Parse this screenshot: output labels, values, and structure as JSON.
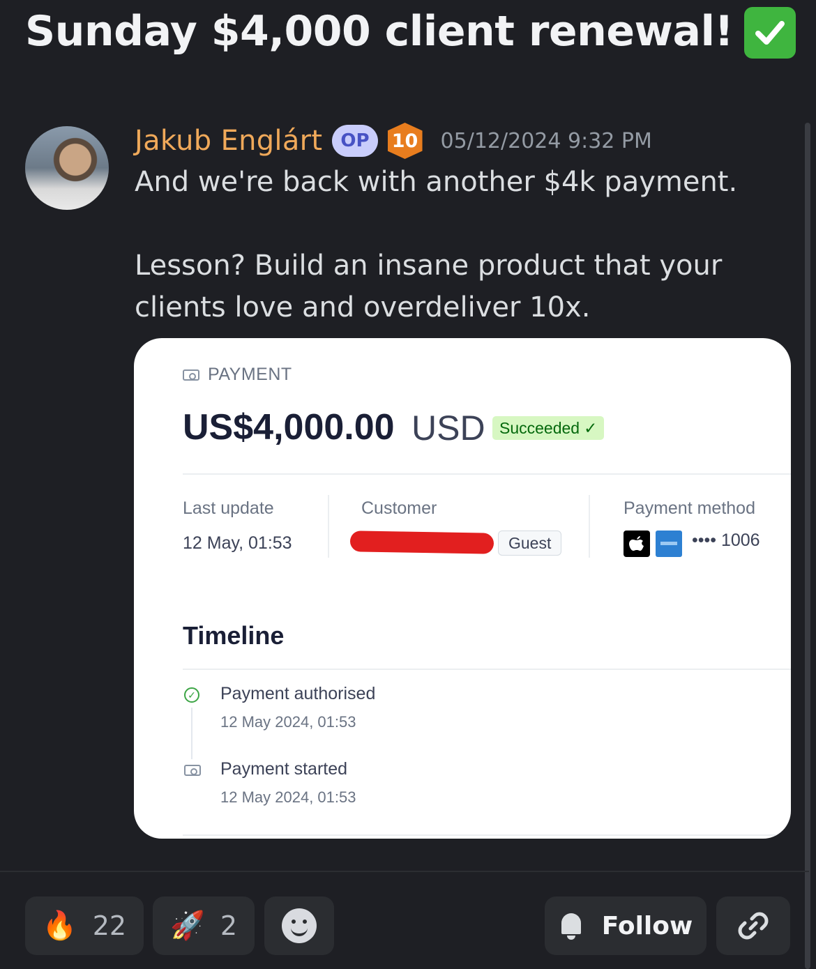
{
  "post": {
    "title": "Sunday $4,000 client renewal!",
    "title_emoji": "✅"
  },
  "message": {
    "author": "Jakub Englárt",
    "op_badge": "OP",
    "level_badge": "10",
    "timestamp": "05/12/2024 9:32 PM",
    "line1": "And we're back with another $4k payment.",
    "line2": "Lesson? Build an insane product that your clients love and overdeliver 10x."
  },
  "payment_card": {
    "header": "PAYMENT",
    "amount": "US$4,000.00",
    "currency": "USD",
    "status": "Succeeded",
    "status_mark": "✓",
    "last_update_label": "Last update",
    "last_update_value": "12 May, 01:53",
    "customer_label": "Customer",
    "customer_badge": "Guest",
    "payment_method_label": "Payment method",
    "card_last4": "•••• 1006",
    "timeline_title": "Timeline",
    "timeline": [
      {
        "title": "Payment authorised",
        "date": "12 May 2024, 01:53"
      },
      {
        "title": "Payment started",
        "date": "12 May 2024, 01:53"
      }
    ]
  },
  "reactions": [
    {
      "emoji": "🔥",
      "count": "22"
    },
    {
      "emoji": "🚀",
      "count": "2"
    }
  ],
  "actions": {
    "follow_label": "Follow"
  },
  "colors": {
    "background": "#1e1f24",
    "author": "#f0a95a",
    "op_badge_bg": "#c9cdfb",
    "status_green": "#d7f7c2",
    "redaction": "#e21f1f"
  }
}
